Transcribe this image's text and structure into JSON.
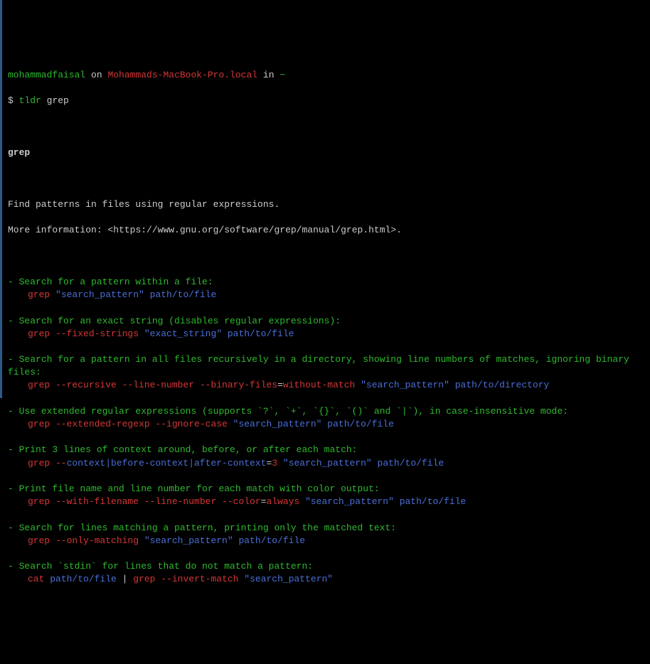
{
  "prompt": {
    "user": "mohammadfaisal",
    "on": "on",
    "host": "Mohammads-MacBook-Pro.local",
    "in": "in",
    "path": "~",
    "ps1": "$",
    "cmd_tldr": "tldr",
    "cmd_arg": "grep"
  },
  "title": "grep",
  "desc1": "Find patterns in files using regular expressions.",
  "desc2a": "More information: <",
  "desc2b": "https://www.gnu.org/software/grep/manual/grep.html",
  "desc2c": ">.",
  "items": [
    {
      "dash": "-",
      "heading": "Search for a pattern within a file:",
      "parts": [
        {
          "t": "grep ",
          "c": "red"
        },
        {
          "t": "\"search_pattern\"",
          "c": "blue"
        },
        {
          "t": " path/to/file",
          "c": "blue"
        }
      ]
    },
    {
      "dash": "-",
      "heading": "Search for an exact string (disables regular expressions):",
      "parts": [
        {
          "t": "grep --fixed-strings ",
          "c": "red"
        },
        {
          "t": "\"exact_string\"",
          "c": "blue"
        },
        {
          "t": " path/to/file",
          "c": "blue"
        }
      ]
    },
    {
      "dash": "-",
      "heading": "Search for a pattern in all files recursively in a directory, showing line numbers of matches, ignoring binary files:",
      "parts": [
        {
          "t": "grep --recursive --line-number --binary-files",
          "c": "red"
        },
        {
          "t": "=",
          "c": "white"
        },
        {
          "t": "without-match ",
          "c": "red"
        },
        {
          "t": "\"search_pattern\"",
          "c": "blue"
        },
        {
          "t": " path/to/directory",
          "c": "blue"
        }
      ]
    },
    {
      "dash": "-",
      "heading": "Use extended regular expressions (supports `?`, `+`, `{}`, `()` and `|`), in case-insensitive mode:",
      "parts": [
        {
          "t": "grep --extended-regexp --ignore-case ",
          "c": "red"
        },
        {
          "t": "\"search_pattern\"",
          "c": "blue"
        },
        {
          "t": " path/to/file",
          "c": "blue"
        }
      ]
    },
    {
      "dash": "-",
      "heading": "Print 3 lines of context around, before, or after each match:",
      "parts": [
        {
          "t": "grep --",
          "c": "red"
        },
        {
          "t": "context|before-context|after-context",
          "c": "blue"
        },
        {
          "t": "=",
          "c": "white"
        },
        {
          "t": "3 ",
          "c": "red"
        },
        {
          "t": "\"search_pattern\"",
          "c": "blue"
        },
        {
          "t": " path/to/file",
          "c": "blue"
        }
      ]
    },
    {
      "dash": "-",
      "heading": "Print file name and line number for each match with color output:",
      "parts": [
        {
          "t": "grep --with-filename --line-number --color",
          "c": "red"
        },
        {
          "t": "=",
          "c": "white"
        },
        {
          "t": "always ",
          "c": "red"
        },
        {
          "t": "\"search_pattern\"",
          "c": "blue"
        },
        {
          "t": " path/to/file",
          "c": "blue"
        }
      ]
    },
    {
      "dash": "-",
      "heading": "Search for lines matching a pattern, printing only the matched text:",
      "parts": [
        {
          "t": "grep --only-matching ",
          "c": "red"
        },
        {
          "t": "\"search_pattern\"",
          "c": "blue"
        },
        {
          "t": " path/to/file",
          "c": "blue"
        }
      ]
    },
    {
      "dash": "-",
      "heading": "Search `stdin` for lines that do not match a pattern:",
      "parts": [
        {
          "t": "cat ",
          "c": "red"
        },
        {
          "t": "path/to/file",
          "c": "blue"
        },
        {
          "t": " | ",
          "c": "white"
        },
        {
          "t": "grep --invert-match ",
          "c": "red"
        },
        {
          "t": "\"search_pattern\"",
          "c": "blue"
        }
      ]
    }
  ]
}
